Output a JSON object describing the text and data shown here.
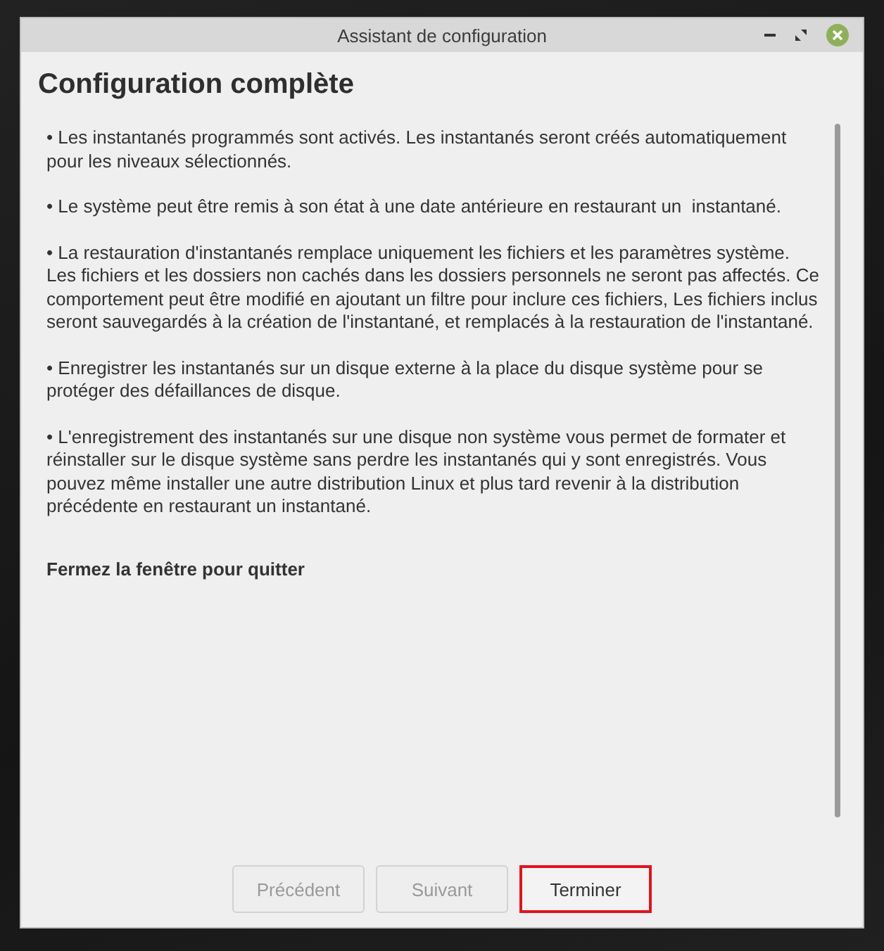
{
  "window": {
    "title": "Assistant de configuration"
  },
  "heading": "Configuration complète",
  "paragraphs": [
    "• Les instantanés programmés sont activés. Les instantanés seront créés automatiquement pour les niveaux sélectionnés.",
    "• Le système peut être remis à son état à une date antérieure en restaurant un  instantané.",
    "• La restauration d'instantanés remplace uniquement les fichiers et les paramètres système. Les fichiers et les dossiers non cachés dans les dossiers personnels ne seront pas affectés. Ce comportement peut être modifié en ajoutant un filtre pour inclure ces fichiers, Les fichiers inclus seront sauvegardés à la création de l'instantané, et remplacés à la restauration de l'instantané.",
    "• Enregistrer les instantanés sur un disque externe à la place du disque système pour se protéger des défaillances de disque.",
    "• L'enregistrement des instantanés sur une disque non système vous permet de formater et réinstaller sur le disque système sans perdre les instantanés qui y sont enregistrés. Vous pouvez même installer une autre distribution Linux et plus tard revenir à la distribution précédente en restaurant un instantané."
  ],
  "closing_note": "Fermez la fenêtre pour quitter",
  "buttons": [
    {
      "label": "Précédent",
      "disabled": true,
      "highlighted": false
    },
    {
      "label": "Suivant",
      "disabled": true,
      "highlighted": false
    },
    {
      "label": "Terminer",
      "disabled": false,
      "highlighted": true
    }
  ]
}
